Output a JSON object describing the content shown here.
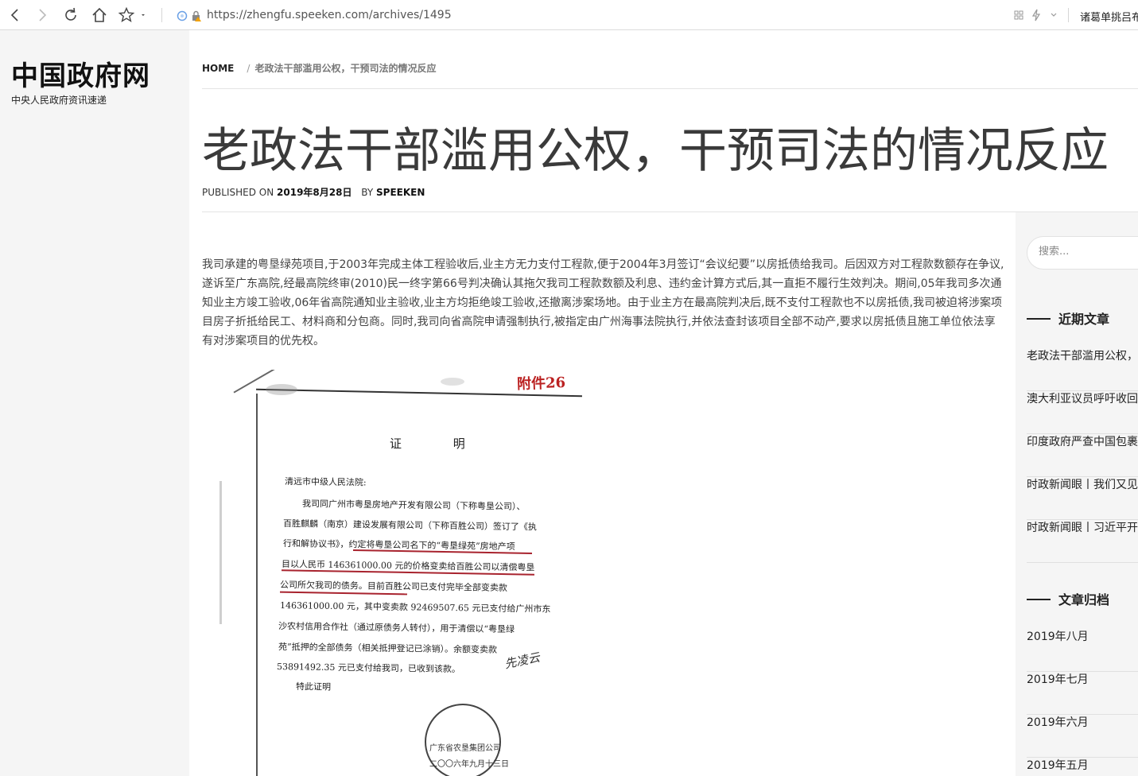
{
  "browser": {
    "url": "https://zhengfu.speeken.com/archives/1495",
    "profile_text": "诸葛单挑吕布"
  },
  "site": {
    "title": "中国政府网",
    "description": "中央人民政府资讯速递"
  },
  "breadcrumb": {
    "home": "HOME",
    "separator": "/",
    "current": "老政法干部滥用公权，干预司法的情况反应"
  },
  "post": {
    "title": "老政法干部滥用公权，干预司法的情况反应",
    "published_label": "PUBLISHED ON",
    "date": "2019年8月28日",
    "by_label": "BY",
    "author": "SPEEKEN",
    "paragraph": "我司承建的粤垦绿苑项目,于2003年完成主体工程验收后,业主方无力支付工程款,便于2004年3月签订“会议纪要”以房抵债给我司。后因双方对工程款数额存在争议,遂诉至广东高院,经最高院终审(2010)民一终字第66号判决确认其拖欠我司工程款数额及利息、违约金计算方式后,其一直拒不履行生效判决。期间,05年我司多次通知业主方竣工验收,06年省高院通知业主验收,业主方均拒绝竣工验收,还撤离涉案场地。由于业主方在最高院判决后,既不支付工程款也不以房抵债,我司被迫将涉案项目房子折抵给民工、材料商和分包商。同时,我司向省高院申请强制执行,被指定由广州海事法院执行,并依法查封该项目全部不动产,要求以房抵债且施工单位依法享有对涉案项目的优先权。"
  },
  "document_image": {
    "attachment_label": "附件26",
    "heading": "证 明",
    "lines": [
      "清远市中级人民法院:",
      "我司同广州市粤垦房地产开发有限公司（下称粤垦公司）、",
      "百胜麒麟（南京）建设发展有限公司（下称百胜公司）签订了《执",
      "行和解协议书》，约定将粤垦公司名下的“粤垦绿苑”房地产项",
      "目以人民币 146361000.00 元的价格变卖给百胜公司以清偿粤垦",
      "公司所欠我司的债务。目前百胜公司已支付完毕全部变卖款",
      "146361000.00 元，其中变卖款 92469507.65 元已支付给广州市东",
      "沙农村信用合作社（通过原债务人转付），用于清偿以“粤垦绿",
      "苑”抵押的全部债务（相关抵押登记已涂销）。余额变卖款",
      "53891492.35 元已支付给我司，已收到该款。",
      "特此证明"
    ],
    "signature": "先凌云",
    "seal_text": "广东省农垦集团公司",
    "seal_date": "二〇〇六年九月十三日"
  },
  "sidebar": {
    "search_placeholder": "搜索...",
    "recent_title": "近期文章",
    "recent_posts": [
      "老政法干部滥用公权，干预司法的情况反应",
      "澳大利亚议员呼吁收回达尔文港",
      "印度政府严查中国包裹",
      "时政新闻眼丨我们又见面了",
      "时政新闻眼丨习近平开启新时代"
    ],
    "archives_title": "文章归档",
    "archives": [
      "2019年八月",
      "2019年七月",
      "2019年六月",
      "2019年五月"
    ]
  }
}
